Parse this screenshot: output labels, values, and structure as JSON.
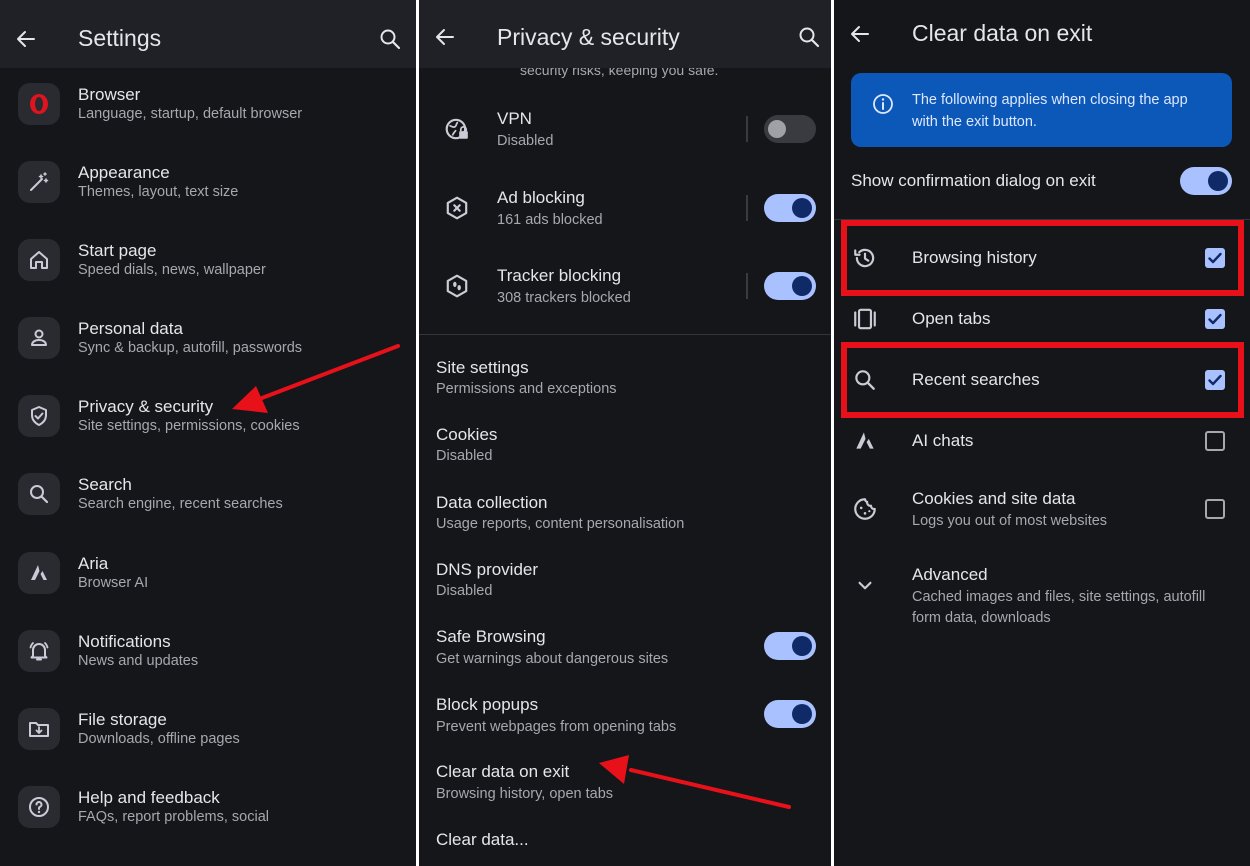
{
  "panel1": {
    "title": "Settings",
    "items": [
      {
        "title": "Browser",
        "subtitle": "Language, startup, default browser",
        "icon": "opera-logo-icon"
      },
      {
        "title": "Appearance",
        "subtitle": "Themes, layout, text size",
        "icon": "magic-wand-icon"
      },
      {
        "title": "Start page",
        "subtitle": "Speed dials, news, wallpaper",
        "icon": "home-icon"
      },
      {
        "title": "Personal data",
        "subtitle": "Sync & backup, autofill, passwords",
        "icon": "person-icon"
      },
      {
        "title": "Privacy & security",
        "subtitle": "Site settings, permissions, cookies",
        "icon": "shield-icon"
      },
      {
        "title": "Search",
        "subtitle": "Search engine, recent searches",
        "icon": "search-icon"
      },
      {
        "title": "Aria",
        "subtitle": "Browser AI",
        "icon": "aria-icon"
      },
      {
        "title": "Notifications",
        "subtitle": "News and updates",
        "icon": "bell-icon"
      },
      {
        "title": "File storage",
        "subtitle": "Downloads, offline pages",
        "icon": "folder-download-icon"
      },
      {
        "title": "Help and feedback",
        "subtitle": "FAQs, report problems, social",
        "icon": "help-icon"
      }
    ]
  },
  "panel2": {
    "title": "Privacy & security",
    "truncated_text": "security risks, keeping you safe.",
    "toggle_items": [
      {
        "title": "VPN",
        "subtitle": "Disabled",
        "icon": "vpn-globe-icon",
        "enabled": false
      },
      {
        "title": "Ad blocking",
        "subtitle": "161 ads blocked",
        "icon": "ad-block-icon",
        "enabled": true
      },
      {
        "title": "Tracker blocking",
        "subtitle": "308 trackers blocked",
        "icon": "tracker-block-icon",
        "enabled": true
      }
    ],
    "items": [
      {
        "title": "Site settings",
        "subtitle": "Permissions and exceptions"
      },
      {
        "title": "Cookies",
        "subtitle": "Disabled"
      },
      {
        "title": "Data collection",
        "subtitle": "Usage reports, content personalisation"
      },
      {
        "title": "DNS provider",
        "subtitle": "Disabled"
      },
      {
        "title": "Safe Browsing",
        "subtitle": "Get warnings about dangerous sites",
        "enabled": true
      },
      {
        "title": "Block popups",
        "subtitle": "Prevent webpages from opening tabs",
        "enabled": true
      },
      {
        "title": "Clear data on exit",
        "subtitle": "Browsing history, open tabs"
      },
      {
        "title": "Clear data...",
        "subtitle": ""
      }
    ]
  },
  "panel3": {
    "title": "Clear data on exit",
    "info_text": "The following applies when closing the app with the exit button.",
    "confirm_label": "Show confirmation dialog on exit",
    "confirm_enabled": true,
    "checkbox_items": [
      {
        "title": "Browsing history",
        "subtitle": "",
        "icon": "history-icon",
        "checked": true
      },
      {
        "title": "Open tabs",
        "subtitle": "",
        "icon": "tabs-icon",
        "checked": true
      },
      {
        "title": "Recent searches",
        "subtitle": "",
        "icon": "search-icon",
        "checked": true
      },
      {
        "title": "AI chats",
        "subtitle": "",
        "icon": "aria-icon",
        "checked": false
      },
      {
        "title": "Cookies and site data",
        "subtitle": "Logs you out of most websites",
        "icon": "cookie-icon",
        "checked": false
      }
    ],
    "advanced": {
      "title": "Advanced",
      "subtitle_line1": "Cached images and files, site settings, autofill",
      "subtitle_line2": "form data, downloads"
    }
  },
  "colors": {
    "background": "#15161a",
    "topbar": "#202126",
    "toggle_on": "#a9c2ff",
    "annotation_red": "#e8111a",
    "info_blue": "#0b58b8"
  }
}
